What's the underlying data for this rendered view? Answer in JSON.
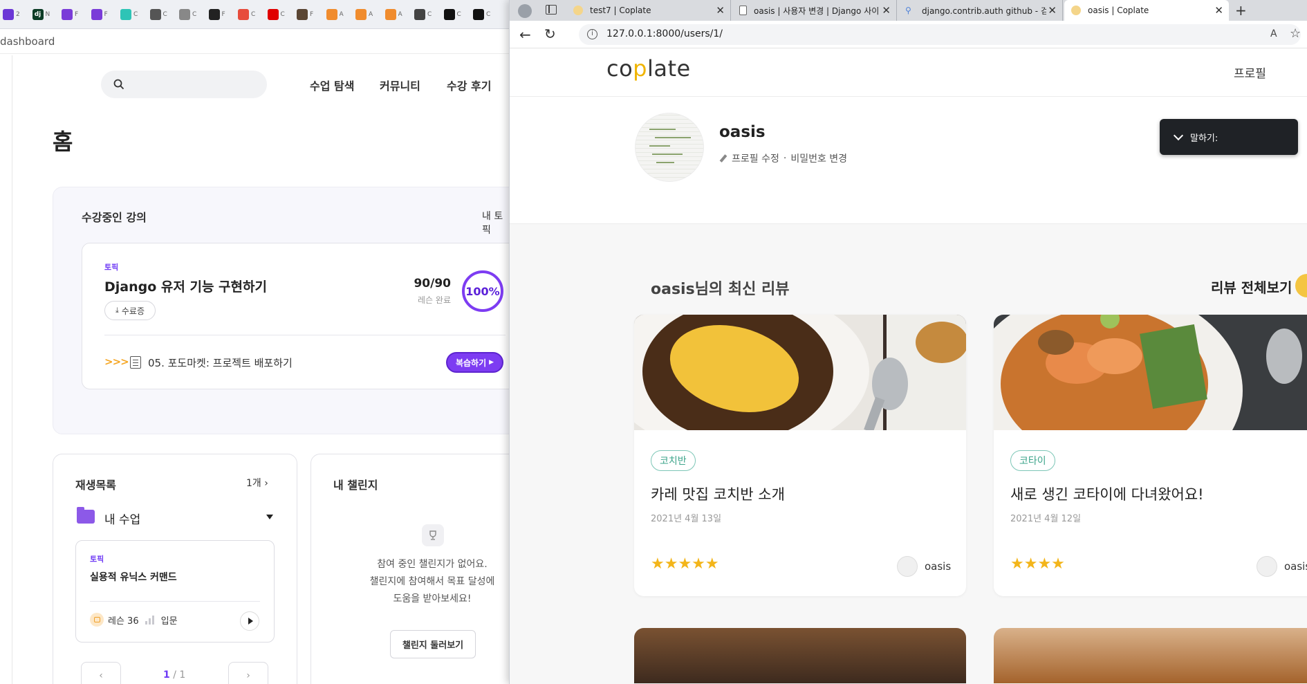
{
  "left_window": {
    "favicon_tabs": [
      {
        "glyph": "",
        "title": "2",
        "color": "#6b37d6"
      },
      {
        "glyph": "dj",
        "title": "N",
        "color": "#0c3c26"
      },
      {
        "glyph": "",
        "title": "F",
        "color": "#7a3cd8"
      },
      {
        "glyph": "",
        "title": "F",
        "color": "#7a3cd8"
      },
      {
        "glyph": "",
        "title": "C",
        "color": "#2ec4b6"
      },
      {
        "glyph": "",
        "title": "C",
        "color": "#555555"
      },
      {
        "glyph": "",
        "title": "C",
        "color": "#888888"
      },
      {
        "glyph": "",
        "title": "F",
        "color": "#222222"
      },
      {
        "glyph": "",
        "title": "C",
        "color": "#e74c3c"
      },
      {
        "glyph": "",
        "title": "C",
        "color": "#e00000"
      },
      {
        "glyph": "",
        "title": "F",
        "color": "#5a4634"
      },
      {
        "glyph": "",
        "title": "A",
        "color": "#f08c2e"
      },
      {
        "glyph": "",
        "title": "A",
        "color": "#f08c2e"
      },
      {
        "glyph": "",
        "title": "A",
        "color": "#f08c2e"
      },
      {
        "glyph": "",
        "title": "C",
        "color": "#444444"
      },
      {
        "glyph": "",
        "title": "C",
        "color": "#111111"
      },
      {
        "glyph": "",
        "title": "C",
        "color": "#111111"
      }
    ],
    "url_fragment": "dashboard",
    "nav": [
      "수업 탐색",
      "커뮤니티",
      "수강 후기"
    ],
    "page_title": "홈",
    "courses_section": {
      "title": "수강중인 강의",
      "right_link": "내 토픽",
      "course": {
        "tag": "토픽",
        "name": "Django 유저 기능 구현하기",
        "cert_label": "수료증",
        "progress_text": "90/90",
        "progress_caption": "레슨 완료",
        "progress_percent_label": "100%",
        "progress_fraction": 1.0,
        "next_lesson_arrows": ">>>",
        "next_lesson": "05. 포도마켓: 프로젝트 배포하기",
        "review_button": "복습하기"
      }
    },
    "playlist": {
      "title": "재생목록",
      "count": "1개",
      "folder_label": "내 수업",
      "item": {
        "tag": "토픽",
        "name": "실용적 유닉스 커맨드",
        "lessons": "레슨 36",
        "level": "입문"
      },
      "pagination": {
        "current": "1",
        "total": "/ 1"
      }
    },
    "challenge": {
      "title": "내 챌린지",
      "empty_line1": "참여 중인 챌린지가 없어요.",
      "empty_line2": "챌린지에 참여해서 목표 달성에",
      "empty_line3": "도움을 받아보세요!",
      "button": "챌린지 둘러보기"
    }
  },
  "right_window": {
    "tabs": [
      {
        "title": "test7 | Coplate",
        "color": "#f4d58a"
      },
      {
        "title": "oasis | 사용자 변경 | Django 사이",
        "color": "#ffffff"
      },
      {
        "title": "django.contrib.auth github - 검색",
        "color": "#4f82d8"
      },
      {
        "title": "oasis | Coplate",
        "color": "#f4d58a"
      }
    ],
    "url": "127.0.0.1:8000/users/1/",
    "read_aloud": "A",
    "site": {
      "logo_part1": "co",
      "logo_bulb": "p",
      "logo_part2": "late",
      "nav_profile": "프로필"
    },
    "profile": {
      "username": "oasis",
      "edit_profile": "프로필 수정",
      "separator": "·",
      "change_password": "비밀번호 변경"
    },
    "say_popup": "말하기:",
    "reviews": {
      "title": "oasis님의 최신 리뷰",
      "view_all": "리뷰 전체보기",
      "cards": [
        {
          "restaurant": "코치반",
          "title": "카레 맛집 코치반 소개",
          "date": "2021년 4월 13일",
          "stars": "★★★★★",
          "rating": 5,
          "author": "oasis"
        },
        {
          "restaurant": "코타이",
          "title": "새로 생긴 코타이에 다녀왔어요!",
          "date": "2021년 4월 12일",
          "stars": "★★★★",
          "rating": 4,
          "author": "oasis"
        }
      ]
    }
  }
}
